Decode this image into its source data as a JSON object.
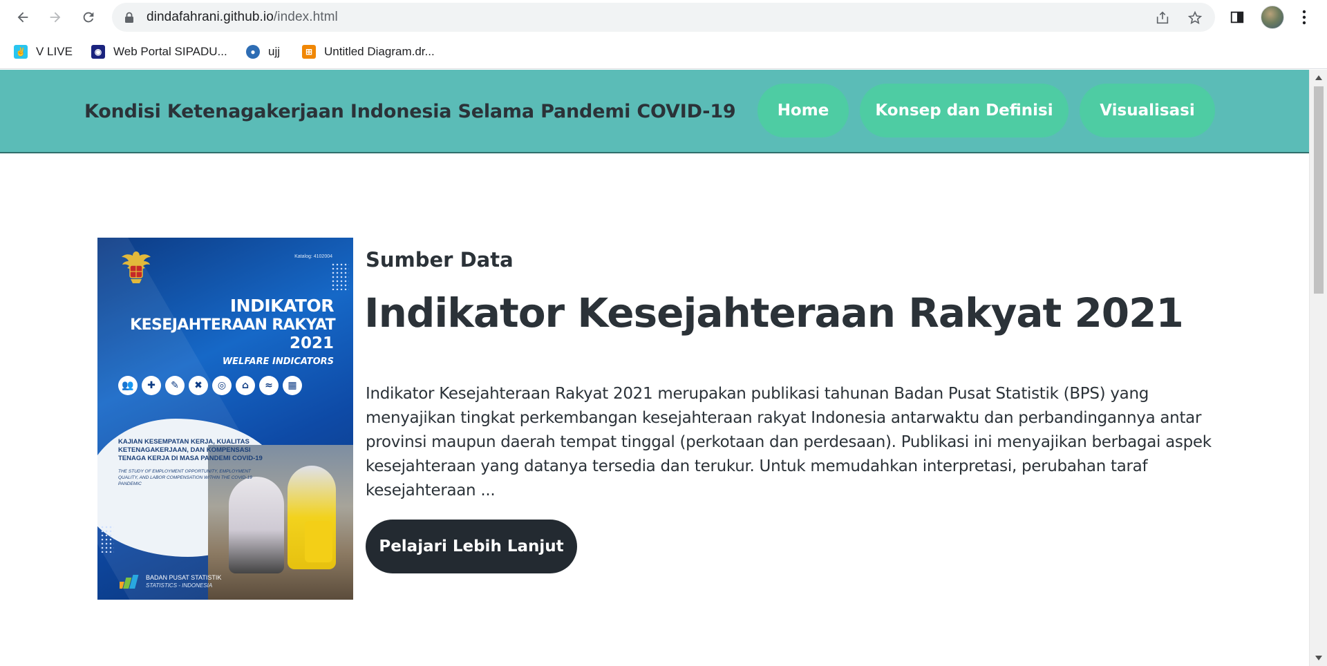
{
  "browser": {
    "url_host": "dindafahrani.github.io",
    "url_path": "/index.html",
    "icons": {
      "back": "arrow-left-icon",
      "forward": "arrow-right-icon",
      "reload": "reload-icon",
      "lock": "lock-icon",
      "share": "share-icon",
      "bookmark": "star-icon",
      "side_panel": "side-panel-icon",
      "profile": "avatar",
      "menu": "kebab-menu-icon"
    }
  },
  "bookmarks": [
    {
      "label": "V LIVE",
      "icon": "vlive-icon",
      "color": "#29c5ef"
    },
    {
      "label": "Web Portal SIPADU...",
      "icon": "sipadu-icon",
      "color": "#1a237e"
    },
    {
      "label": "ujj",
      "icon": "globe-icon",
      "color": "#2e6db4"
    },
    {
      "label": "Untitled Diagram.dr...",
      "icon": "drawio-icon",
      "color": "#f08705"
    }
  ],
  "header": {
    "title": "Kondisi Ketenagakerjaan Indonesia Selama Pandemi COVID-19",
    "nav": [
      {
        "label": "Home"
      },
      {
        "label": "Konsep dan Definisi"
      },
      {
        "label": "Visualisasi"
      }
    ],
    "bg_color": "#5bbcb7",
    "pill_color": "#4ecca3"
  },
  "cover": {
    "katalog": "Katalog: 4102004",
    "title_line1": "INDIKATOR",
    "title_line2": "KESEJAHTERAAN RAKYAT",
    "title_line3": "2021",
    "title_en": "WELFARE INDICATORS",
    "subtitle": "KAJIAN KESEMPATAN KERJA, KUALITAS KETENAGAKERJAAN, DAN KOMPENSASI TENAGA KERJA DI MASA PANDEMI COVID-19",
    "subtitle_en": "THE STUDY OF EMPLOYMENT OPPORTUNITY, EMPLOYMENT QUALITY, AND LABOR COMPENSATION WITHIN THE COVID-19 PANDEMIC",
    "publisher": "BADAN PUSAT STATISTIK",
    "publisher_en": "STATISTICS - INDONESIA"
  },
  "main": {
    "eyebrow": "Sumber Data",
    "headline": "Indikator Kesejahteraan Rakyat 2021",
    "description": "Indikator Kesejahteraan Rakyat 2021 merupakan publikasi tahunan Badan Pusat Statistik (BPS) yang menyajikan tingkat perkembangan kesejahteraan rakyat Indonesia antarwaktu dan perbandingannya antar provinsi maupun daerah tempat tinggal (perkotaan dan perdesaan). Publikasi ini menyajikan berbagai aspek kesejahteraan yang datanya tersedia dan terukur. Untuk memudahkan interpretasi, perubahan taraf kesejahteraan ...",
    "cta_label": "Pelajari Lebih Lanjut",
    "cta_color": "#232a31"
  }
}
